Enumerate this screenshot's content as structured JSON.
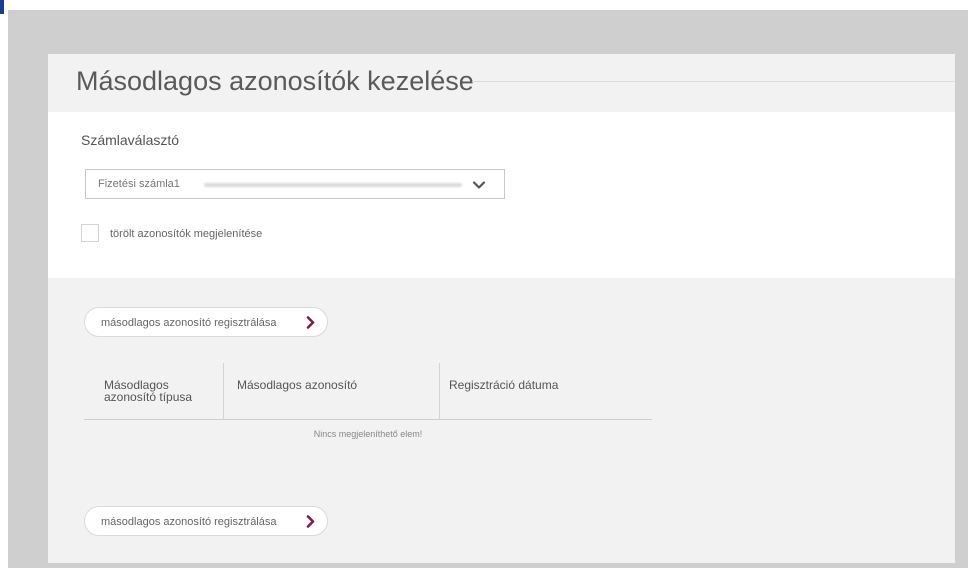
{
  "page": {
    "title": "Másodlagos azonosítók kezelése"
  },
  "account_selector": {
    "label": "Számlaválasztó",
    "selected_value": "Fizetési számla1"
  },
  "show_deleted": {
    "label": "törölt azonosítók megjelenítése",
    "checked": false
  },
  "register_button": {
    "label": "másodlagos azonosító regisztrálása"
  },
  "table": {
    "columns": [
      "Másodlagos azonosító típusa",
      "Másodlagos azonosító",
      "Regisztráció dátuma"
    ],
    "rows": [],
    "empty_message": "Nincs megjeleníthető elem!"
  },
  "colors": {
    "accent": "#7a1e4e",
    "frame": "#cfcfcf",
    "panel": "#f2f2f2"
  }
}
